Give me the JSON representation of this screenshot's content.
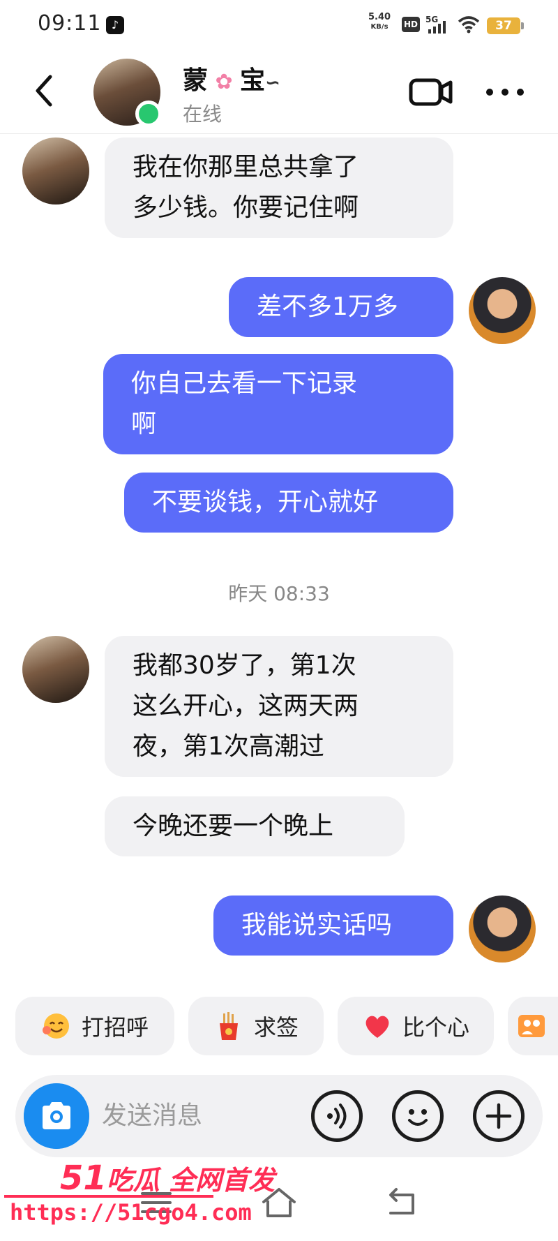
{
  "status_bar": {
    "time": "09:11",
    "net_speed_value": "5.40",
    "net_speed_unit": "KB/s",
    "hd": "HD",
    "network": "5G",
    "battery": "37"
  },
  "header": {
    "contact_name_a": "蒙",
    "contact_name_b": "宝",
    "status": "在线"
  },
  "messages": [
    {
      "side": "in",
      "text": "我在你那里总共拿了\n多少钱。你要记住啊"
    },
    {
      "side": "out",
      "text": "差不多1万多"
    },
    {
      "side": "out",
      "text": "你自己去看一下记录\n啊"
    },
    {
      "side": "out",
      "text": "不要谈钱，开心就好"
    },
    {
      "side": "in",
      "text": "我都30岁了，第1次\n这么开心，这两天两\n夜，第1次高潮过"
    },
    {
      "side": "in",
      "text": "今晚还要一个晚上"
    },
    {
      "side": "out",
      "text": "我能说实话吗"
    }
  ],
  "timestamp": "昨天 08:33",
  "quick_actions": [
    {
      "label": "打招呼",
      "icon": "smile-wave-icon"
    },
    {
      "label": "求签",
      "icon": "fortune-sticks-icon"
    },
    {
      "label": "比个心",
      "icon": "red-heart-icon"
    },
    {
      "label": "",
      "icon": "group-photo-icon"
    }
  ],
  "input": {
    "placeholder": "发送消息"
  },
  "watermark": {
    "brand_num": "51",
    "brand_text": "吃瓜 全网首发",
    "url": "https://51cgo4.com"
  },
  "colors": {
    "outgoing_bubble": "#5b6cf9",
    "incoming_bubble": "#f1f1f3",
    "online": "#28c76f",
    "camera_button": "#1a8cf0",
    "watermark": "#ff2d55"
  }
}
